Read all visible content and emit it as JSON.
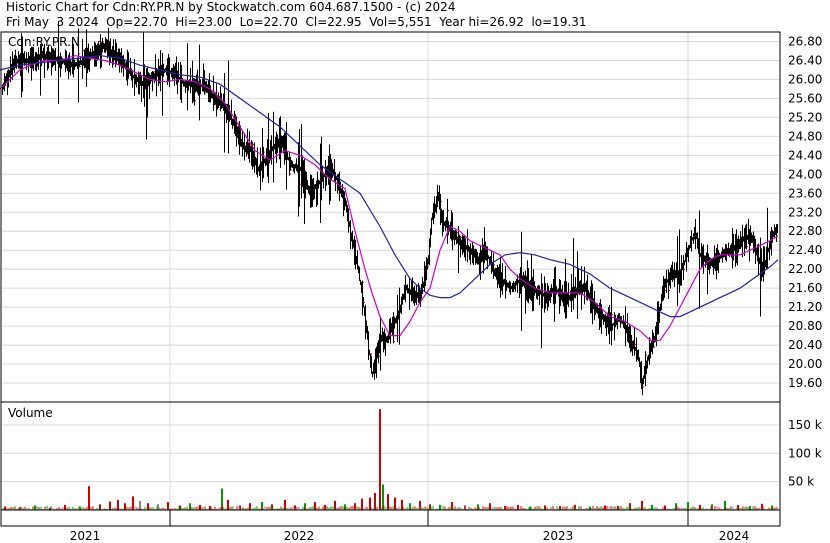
{
  "header": {
    "line1": "Historic Chart for Cdn:RY.PR.N by Stockwatch.com 604.687.1500 - (c) 2024",
    "line2": "Fri May  3 2024  Op=22.70  Hi=23.00  Lo=22.70  Cl=22.95  Vol=5,551  Year hi=26.92  lo=19.31"
  },
  "chart_data": [
    {
      "type": "line",
      "title": "Cdn:RY.PR.N",
      "x_ticks": [
        "2021",
        "2022",
        "2023",
        "2024"
      ],
      "y_ticks": [
        "26.80",
        "26.40",
        "26.00",
        "25.60",
        "25.20",
        "24.80",
        "24.40",
        "24.00",
        "23.60",
        "23.20",
        "22.80",
        "22.40",
        "22.00",
        "21.60",
        "21.20",
        "20.80",
        "20.40",
        "20.00",
        "19.60"
      ],
      "ylim": [
        19.2,
        27.0
      ],
      "colors": {
        "price": "#000000",
        "ma_short": "#cc00cc",
        "ma_long": "#2222aa",
        "close_tick": "#cc0000"
      },
      "series": [
        {
          "role": "price",
          "x": [
            0,
            4,
            8,
            12,
            18,
            30,
            45,
            60,
            75,
            90,
            105,
            115,
            125,
            135,
            145,
            155,
            165,
            175,
            185,
            195,
            205,
            215,
            225,
            235,
            242,
            250,
            258,
            265,
            275,
            282,
            290,
            300,
            310,
            318,
            325,
            330,
            338,
            345,
            352,
            358,
            362,
            368,
            372,
            378,
            382,
            386,
            392,
            398,
            405,
            412,
            420,
            428,
            432,
            438,
            442,
            448,
            455,
            462,
            470,
            478,
            485,
            495,
            505,
            512,
            520,
            530,
            540,
            548,
            555,
            562,
            570,
            578,
            585,
            592,
            598,
            605,
            612,
            618,
            625,
            632,
            638,
            642,
            646,
            650,
            655,
            660,
            665,
            672,
            680,
            688,
            695,
            700,
            708,
            715,
            722,
            730,
            738,
            745,
            752,
            758,
            762,
            766,
            770,
            775,
            778
          ],
          "y": [
            25.7,
            25.9,
            26.1,
            26.3,
            26.4,
            26.4,
            26.5,
            26.4,
            26.3,
            26.5,
            26.7,
            26.5,
            26.3,
            26.0,
            25.9,
            26.1,
            26.2,
            26.1,
            25.9,
            25.9,
            25.85,
            25.6,
            25.4,
            25.0,
            24.6,
            24.5,
            24.1,
            24.3,
            24.6,
            24.7,
            24.2,
            24.1,
            23.6,
            23.8,
            24.0,
            24.2,
            23.8,
            23.4,
            22.6,
            22.0,
            21.5,
            20.4,
            19.8,
            20.3,
            20.6,
            20.5,
            20.8,
            21.0,
            21.6,
            21.5,
            21.4,
            22.2,
            23.1,
            23.5,
            23.0,
            22.9,
            22.7,
            22.5,
            22.4,
            22.2,
            22.4,
            21.9,
            21.7,
            21.6,
            21.8,
            21.6,
            21.5,
            21.4,
            21.6,
            21.4,
            21.4,
            21.6,
            21.6,
            21.3,
            21.1,
            20.9,
            20.8,
            21.0,
            20.8,
            20.4,
            20.2,
            19.6,
            20.0,
            20.3,
            20.6,
            21.2,
            21.7,
            21.9,
            21.9,
            22.4,
            22.8,
            22.3,
            22.1,
            22.2,
            22.3,
            22.4,
            22.5,
            22.7,
            22.6,
            22.2,
            22.0,
            22.2,
            22.6,
            22.8,
            22.9
          ]
        },
        {
          "role": "ma_short",
          "x": [
            0,
            10,
            20,
            30,
            45,
            60,
            75,
            90,
            105,
            120,
            135,
            150,
            165,
            180,
            195,
            210,
            225,
            240,
            255,
            270,
            285,
            300,
            315,
            330,
            345,
            355,
            365,
            372,
            380,
            390,
            400,
            410,
            420,
            430,
            440,
            450,
            460,
            470,
            480,
            490,
            500,
            510,
            520,
            535,
            550,
            565,
            580,
            595,
            610,
            625,
            640,
            650,
            660,
            670,
            680,
            690,
            700,
            710,
            720,
            730,
            740,
            750,
            760,
            770,
            778
          ],
          "y": [
            25.8,
            26.0,
            26.2,
            26.3,
            26.4,
            26.4,
            26.5,
            26.45,
            26.4,
            26.3,
            26.15,
            26.0,
            25.95,
            26.0,
            25.95,
            25.8,
            25.5,
            25.0,
            24.5,
            24.3,
            24.5,
            24.4,
            24.2,
            23.9,
            23.7,
            22.8,
            22.0,
            21.5,
            21.0,
            20.6,
            20.6,
            20.9,
            21.3,
            21.6,
            22.4,
            22.9,
            22.8,
            22.6,
            22.5,
            22.4,
            22.3,
            22.0,
            21.8,
            21.6,
            21.5,
            21.5,
            21.5,
            21.3,
            21.0,
            20.9,
            20.7,
            20.5,
            20.5,
            20.8,
            21.2,
            21.6,
            22.0,
            22.2,
            22.3,
            22.3,
            22.3,
            22.4,
            22.5,
            22.6,
            22.7
          ]
        },
        {
          "role": "ma_long",
          "x": [
            0,
            20,
            40,
            60,
            80,
            100,
            120,
            140,
            160,
            180,
            200,
            220,
            240,
            260,
            280,
            300,
            320,
            340,
            360,
            380,
            395,
            410,
            420,
            430,
            440,
            450,
            460,
            475,
            490,
            505,
            520,
            535,
            550,
            570,
            590,
            610,
            630,
            650,
            660,
            670,
            680,
            690,
            700,
            710,
            720,
            730,
            740,
            750,
            760,
            770,
            778
          ],
          "y": [
            26.2,
            26.3,
            26.35,
            26.4,
            26.45,
            26.5,
            26.45,
            26.3,
            26.2,
            26.1,
            26.05,
            25.9,
            25.6,
            25.3,
            25.0,
            24.6,
            24.2,
            23.9,
            23.6,
            22.9,
            22.3,
            21.8,
            21.6,
            21.45,
            21.4,
            21.4,
            21.5,
            21.8,
            22.1,
            22.3,
            22.35,
            22.3,
            22.2,
            22.1,
            21.9,
            21.6,
            21.4,
            21.2,
            21.1,
            21.0,
            21.0,
            21.1,
            21.2,
            21.3,
            21.4,
            21.5,
            21.6,
            21.75,
            21.9,
            22.05,
            22.2
          ]
        }
      ]
    },
    {
      "type": "bar",
      "title": "Volume",
      "y_ticks": [
        "150 k",
        "100 k",
        "50 k"
      ],
      "ylim": [
        0,
        180000
      ],
      "colors": {
        "down": "#cc0000",
        "up": "#009900",
        "flat": "#888888"
      },
      "volumes": [
        {
          "x": 5,
          "v": 6000,
          "c": "down"
        },
        {
          "x": 20,
          "v": 5000,
          "c": "down"
        },
        {
          "x": 35,
          "v": 8000,
          "c": "up"
        },
        {
          "x": 50,
          "v": 4000,
          "c": "down"
        },
        {
          "x": 65,
          "v": 9000,
          "c": "down"
        },
        {
          "x": 80,
          "v": 6000,
          "c": "up"
        },
        {
          "x": 89,
          "v": 42000,
          "c": "down"
        },
        {
          "x": 100,
          "v": 10000,
          "c": "down"
        },
        {
          "x": 110,
          "v": 15000,
          "c": "down"
        },
        {
          "x": 118,
          "v": 18000,
          "c": "down"
        },
        {
          "x": 125,
          "v": 12000,
          "c": "down"
        },
        {
          "x": 133,
          "v": 24000,
          "c": "down"
        },
        {
          "x": 140,
          "v": 16000,
          "c": "flat"
        },
        {
          "x": 148,
          "v": 12000,
          "c": "down"
        },
        {
          "x": 158,
          "v": 10000,
          "c": "flat"
        },
        {
          "x": 168,
          "v": 14000,
          "c": "down"
        },
        {
          "x": 180,
          "v": 8000,
          "c": "down"
        },
        {
          "x": 190,
          "v": 12000,
          "c": "up"
        },
        {
          "x": 200,
          "v": 9000,
          "c": "down"
        },
        {
          "x": 210,
          "v": 7000,
          "c": "down"
        },
        {
          "x": 222,
          "v": 38000,
          "c": "up"
        },
        {
          "x": 228,
          "v": 18000,
          "c": "down"
        },
        {
          "x": 240,
          "v": 8000,
          "c": "down"
        },
        {
          "x": 250,
          "v": 12000,
          "c": "down"
        },
        {
          "x": 262,
          "v": 14000,
          "c": "up"
        },
        {
          "x": 272,
          "v": 10000,
          "c": "down"
        },
        {
          "x": 285,
          "v": 18000,
          "c": "down"
        },
        {
          "x": 295,
          "v": 8000,
          "c": "down"
        },
        {
          "x": 305,
          "v": 12000,
          "c": "up"
        },
        {
          "x": 315,
          "v": 14000,
          "c": "down"
        },
        {
          "x": 325,
          "v": 9000,
          "c": "down"
        },
        {
          "x": 335,
          "v": 16000,
          "c": "down"
        },
        {
          "x": 345,
          "v": 10000,
          "c": "up"
        },
        {
          "x": 355,
          "v": 12000,
          "c": "down"
        },
        {
          "x": 362,
          "v": 20000,
          "c": "down"
        },
        {
          "x": 370,
          "v": 22000,
          "c": "down"
        },
        {
          "x": 375,
          "v": 30000,
          "c": "down"
        },
        {
          "x": 380,
          "v": 178000,
          "c": "down"
        },
        {
          "x": 383,
          "v": 45000,
          "c": "up"
        },
        {
          "x": 388,
          "v": 28000,
          "c": "down"
        },
        {
          "x": 395,
          "v": 22000,
          "c": "down"
        },
        {
          "x": 402,
          "v": 18000,
          "c": "down"
        },
        {
          "x": 410,
          "v": 12000,
          "c": "up"
        },
        {
          "x": 420,
          "v": 16000,
          "c": "down"
        },
        {
          "x": 430,
          "v": 10000,
          "c": "down"
        },
        {
          "x": 440,
          "v": 9000,
          "c": "up"
        },
        {
          "x": 452,
          "v": 14000,
          "c": "down"
        },
        {
          "x": 465,
          "v": 8000,
          "c": "down"
        },
        {
          "x": 478,
          "v": 10000,
          "c": "up"
        },
        {
          "x": 490,
          "v": 12000,
          "c": "down"
        },
        {
          "x": 505,
          "v": 7000,
          "c": "down"
        },
        {
          "x": 518,
          "v": 9000,
          "c": "down"
        },
        {
          "x": 530,
          "v": 6000,
          "c": "up"
        },
        {
          "x": 545,
          "v": 8000,
          "c": "down"
        },
        {
          "x": 560,
          "v": 7000,
          "c": "down"
        },
        {
          "x": 575,
          "v": 9000,
          "c": "down"
        },
        {
          "x": 590,
          "v": 6000,
          "c": "up"
        },
        {
          "x": 605,
          "v": 8000,
          "c": "down"
        },
        {
          "x": 618,
          "v": 7000,
          "c": "down"
        },
        {
          "x": 630,
          "v": 12000,
          "c": "down"
        },
        {
          "x": 642,
          "v": 16000,
          "c": "down"
        },
        {
          "x": 652,
          "v": 9000,
          "c": "up"
        },
        {
          "x": 665,
          "v": 8000,
          "c": "down"
        },
        {
          "x": 676,
          "v": 12000,
          "c": "up"
        },
        {
          "x": 688,
          "v": 14000,
          "c": "up"
        },
        {
          "x": 700,
          "v": 9000,
          "c": "down"
        },
        {
          "x": 712,
          "v": 10000,
          "c": "up"
        },
        {
          "x": 725,
          "v": 16000,
          "c": "up"
        },
        {
          "x": 738,
          "v": 9000,
          "c": "down"
        },
        {
          "x": 750,
          "v": 7000,
          "c": "up"
        },
        {
          "x": 762,
          "v": 11000,
          "c": "down"
        },
        {
          "x": 772,
          "v": 8000,
          "c": "up"
        }
      ]
    }
  ]
}
